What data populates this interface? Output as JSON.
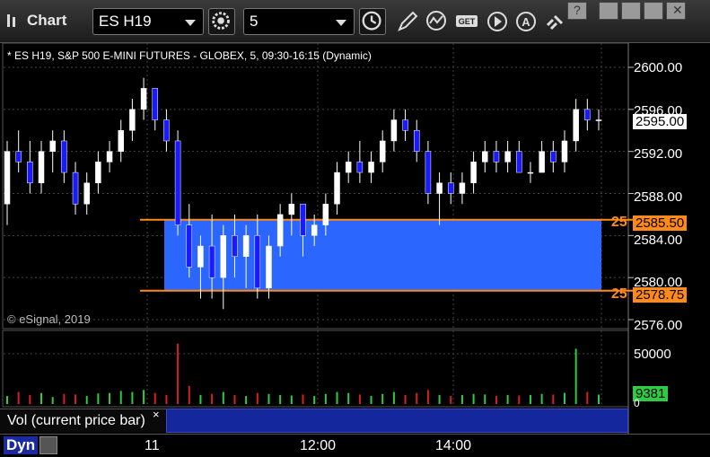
{
  "app": {
    "title": "Chart"
  },
  "toolbar": {
    "symbol": "ES H19",
    "interval": "5"
  },
  "chart": {
    "info": "* ES H19, S&P 500 E-MINI FUTURES - GLOBEX, 5, 09:30-16:15 (Dynamic)",
    "copyright": "© eSignal, 2019",
    "price_ticks": [
      "2600.00",
      "2596.00",
      "2592.00",
      "2588.00",
      "2584.00",
      "2580.00",
      "2576.00"
    ],
    "last_price": "2595.00",
    "upper_level": {
      "label": "2585.50",
      "count": "25"
    },
    "lower_level": {
      "label": "2578.75",
      "count": "25"
    },
    "volume_tick": "50000",
    "volume_zero": "0",
    "current_volume": "9381",
    "volume_legend": "Vol (current price bar)",
    "close_symbol": "×",
    "time_labels": [
      "11",
      "12:00",
      "14:00"
    ],
    "dyn_label": "Dyn",
    "colors": {
      "up": "#ffffff",
      "down": "#1a1aff",
      "zone": "#2a66ff",
      "level": "#ff8a1a",
      "vol_up": "#2ecc40",
      "vol_down": "#d62020"
    }
  },
  "chart_data": {
    "type": "candlestick",
    "title": "",
    "ylim": [
      2575,
      2602
    ],
    "ohlc": [
      [
        2587,
        2593,
        2585,
        2592
      ],
      [
        2592,
        2594,
        2590,
        2591
      ],
      [
        2591,
        2593,
        2588,
        2589
      ],
      [
        2589,
        2593,
        2588,
        2592
      ],
      [
        2592,
        2594,
        2590,
        2593
      ],
      [
        2593,
        2594,
        2589,
        2590
      ],
      [
        2590,
        2591,
        2586,
        2587
      ],
      [
        2587,
        2590,
        2586,
        2589
      ],
      [
        2589,
        2592,
        2588,
        2591
      ],
      [
        2591,
        2593,
        2590,
        2592
      ],
      [
        2592,
        2595,
        2591,
        2594
      ],
      [
        2594,
        2597,
        2593,
        2596
      ],
      [
        2596,
        2599,
        2595,
        2598
      ],
      [
        2598,
        2598,
        2594,
        2595
      ],
      [
        2595,
        2596,
        2592,
        2593
      ],
      [
        2593,
        2594,
        2584,
        2585
      ],
      [
        2585,
        2587,
        2580,
        2581
      ],
      [
        2581,
        2584,
        2578,
        2583
      ],
      [
        2583,
        2586,
        2578,
        2580
      ],
      [
        2580,
        2585,
        2577,
        2584
      ],
      [
        2584,
        2586,
        2580,
        2582
      ],
      [
        2582,
        2585,
        2579,
        2584
      ],
      [
        2584,
        2586,
        2578,
        2579
      ],
      [
        2579,
        2584,
        2578,
        2583
      ],
      [
        2583,
        2587,
        2582,
        2586
      ],
      [
        2586,
        2588,
        2584,
        2587
      ],
      [
        2587,
        2587,
        2582,
        2584
      ],
      [
        2584,
        2586,
        2583,
        2585
      ],
      [
        2585,
        2588,
        2584,
        2587
      ],
      [
        2587,
        2591,
        2586,
        2590
      ],
      [
        2590,
        2592,
        2589,
        2591
      ],
      [
        2591,
        2593,
        2589,
        2590
      ],
      [
        2590,
        2592,
        2589,
        2591
      ],
      [
        2591,
        2594,
        2590,
        2593
      ],
      [
        2593,
        2596,
        2592,
        2595
      ],
      [
        2595,
        2596,
        2593,
        2594
      ],
      [
        2594,
        2595,
        2591,
        2592
      ],
      [
        2592,
        2593,
        2587,
        2588
      ],
      [
        2588,
        2590,
        2585,
        2589
      ],
      [
        2589,
        2590,
        2587,
        2588
      ],
      [
        2588,
        2590,
        2587,
        2589
      ],
      [
        2589,
        2592,
        2588,
        2591
      ],
      [
        2591,
        2593,
        2590,
        2592
      ],
      [
        2592,
        2593,
        2590,
        2591
      ],
      [
        2591,
        2593,
        2590,
        2592
      ],
      [
        2592,
        2593,
        2590,
        2590
      ],
      [
        2590,
        2591,
        2589,
        2590
      ],
      [
        2590,
        2593,
        2590,
        2592
      ],
      [
        2592,
        2593,
        2590,
        2591
      ],
      [
        2591,
        2594,
        2590,
        2593
      ],
      [
        2593,
        2597,
        2592,
        2596
      ],
      [
        2596,
        2597,
        2594,
        2595
      ],
      [
        2595,
        2596,
        2594,
        2595
      ]
    ],
    "volume": [
      8000,
      12000,
      9000,
      11000,
      7000,
      10000,
      9500,
      8000,
      10500,
      11000,
      13000,
      12000,
      14000,
      11000,
      9000,
      60000,
      18000,
      9000,
      10000,
      12000,
      9000,
      8000,
      11000,
      10000,
      9000,
      8500,
      9500,
      8000,
      10000,
      12000,
      11000,
      9500,
      8000,
      10000,
      12000,
      9000,
      11000,
      14000,
      9000,
      8000,
      9000,
      10000,
      9500,
      8000,
      9000,
      8500,
      9000,
      10000,
      9500,
      11000,
      55000,
      12000,
      9381
    ]
  }
}
